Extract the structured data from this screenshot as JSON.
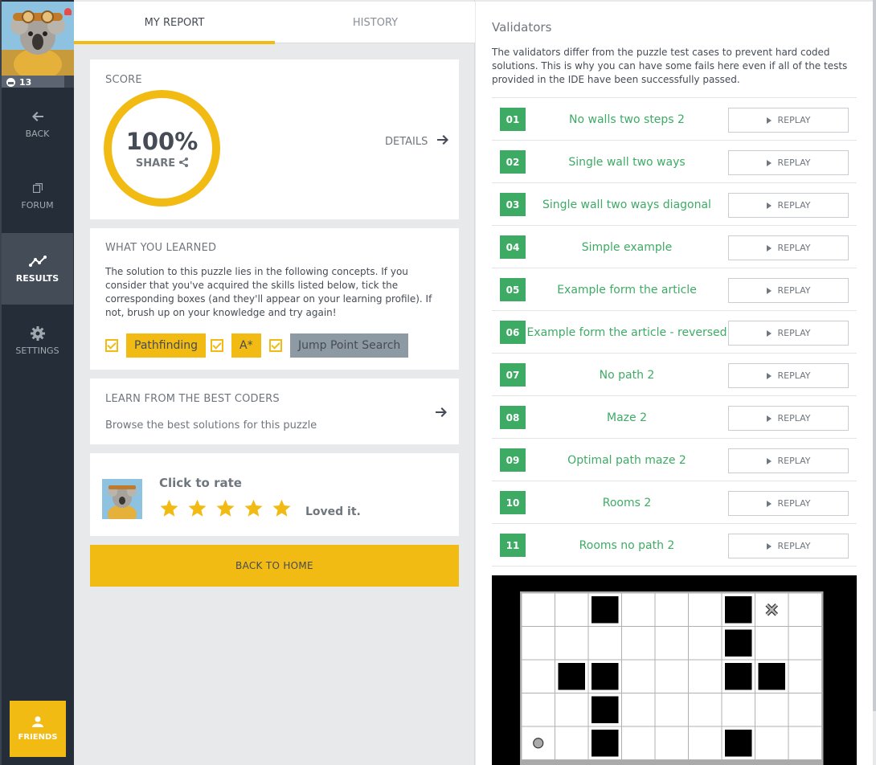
{
  "sidebar": {
    "avatar_level": "13",
    "nav": [
      {
        "label": "BACK",
        "icon": "arrow-left-icon"
      },
      {
        "label": "FORUM",
        "icon": "forum-icon"
      },
      {
        "label": "RESULTS",
        "icon": "results-chart-icon",
        "active": true
      },
      {
        "label": "SETTINGS",
        "icon": "gear-icon"
      }
    ],
    "friends_label": "FRIENDS"
  },
  "tabs": {
    "my_report": "MY REPORT",
    "history": "HISTORY",
    "active": "MY REPORT"
  },
  "score": {
    "label": "SCORE",
    "value": "100%",
    "share_label": "SHARE",
    "details_label": "DETAILS"
  },
  "learned": {
    "label": "WHAT YOU LEARNED",
    "text": "The solution to this puzzle lies in the following concepts. If you consider that you've acquired the skills listed below, tick the corresponding boxes (and they'll appear on your learning profile). If not, brush up on your knowledge and try again!",
    "skills": [
      {
        "label": "Pathfinding",
        "checked": true
      },
      {
        "label": "A*",
        "checked": true
      },
      {
        "label": "Jump Point Search",
        "checked": true
      }
    ]
  },
  "learn_best": {
    "label": "LEARN FROM THE BEST CODERS",
    "text": "Browse the best solutions for this puzzle"
  },
  "rating": {
    "label": "Click to rate",
    "stars": 5,
    "stars_filled": 5,
    "comment": "Loved it."
  },
  "back_home_label": "BACK TO HOME",
  "validators": {
    "title": "Validators",
    "description": "The validators differ from the puzzle test cases to prevent hard coded solutions. This is why you can have some fails here even if all of the tests provided in the IDE have been successfully passed.",
    "replay_label": "REPLAY",
    "items": [
      {
        "num": "01",
        "name": "No walls two steps 2"
      },
      {
        "num": "02",
        "name": "Single wall two ways"
      },
      {
        "num": "03",
        "name": "Single wall two ways diagonal"
      },
      {
        "num": "04",
        "name": "Simple example"
      },
      {
        "num": "05",
        "name": "Example form the article"
      },
      {
        "num": "06",
        "name": "Example form the article - reversed"
      },
      {
        "num": "07",
        "name": "No path 2"
      },
      {
        "num": "08",
        "name": "Maze 2"
      },
      {
        "num": "09",
        "name": "Optimal path maze 2"
      },
      {
        "num": "10",
        "name": "Rooms 2"
      },
      {
        "num": "11",
        "name": "Rooms no path 2"
      }
    ]
  },
  "grid": {
    "cols": 9,
    "visible_rows": 5,
    "walls": [
      [
        0,
        2
      ],
      [
        0,
        6
      ],
      [
        1,
        6
      ],
      [
        2,
        1
      ],
      [
        2,
        2
      ],
      [
        2,
        6
      ],
      [
        2,
        7
      ],
      [
        3,
        2
      ],
      [
        4,
        2
      ],
      [
        4,
        6
      ]
    ],
    "goal": [
      0,
      7
    ],
    "start": [
      4,
      0
    ]
  },
  "colors": {
    "accent": "#f2bb13",
    "success": "#3eab65",
    "sidebar": "#252e38"
  }
}
